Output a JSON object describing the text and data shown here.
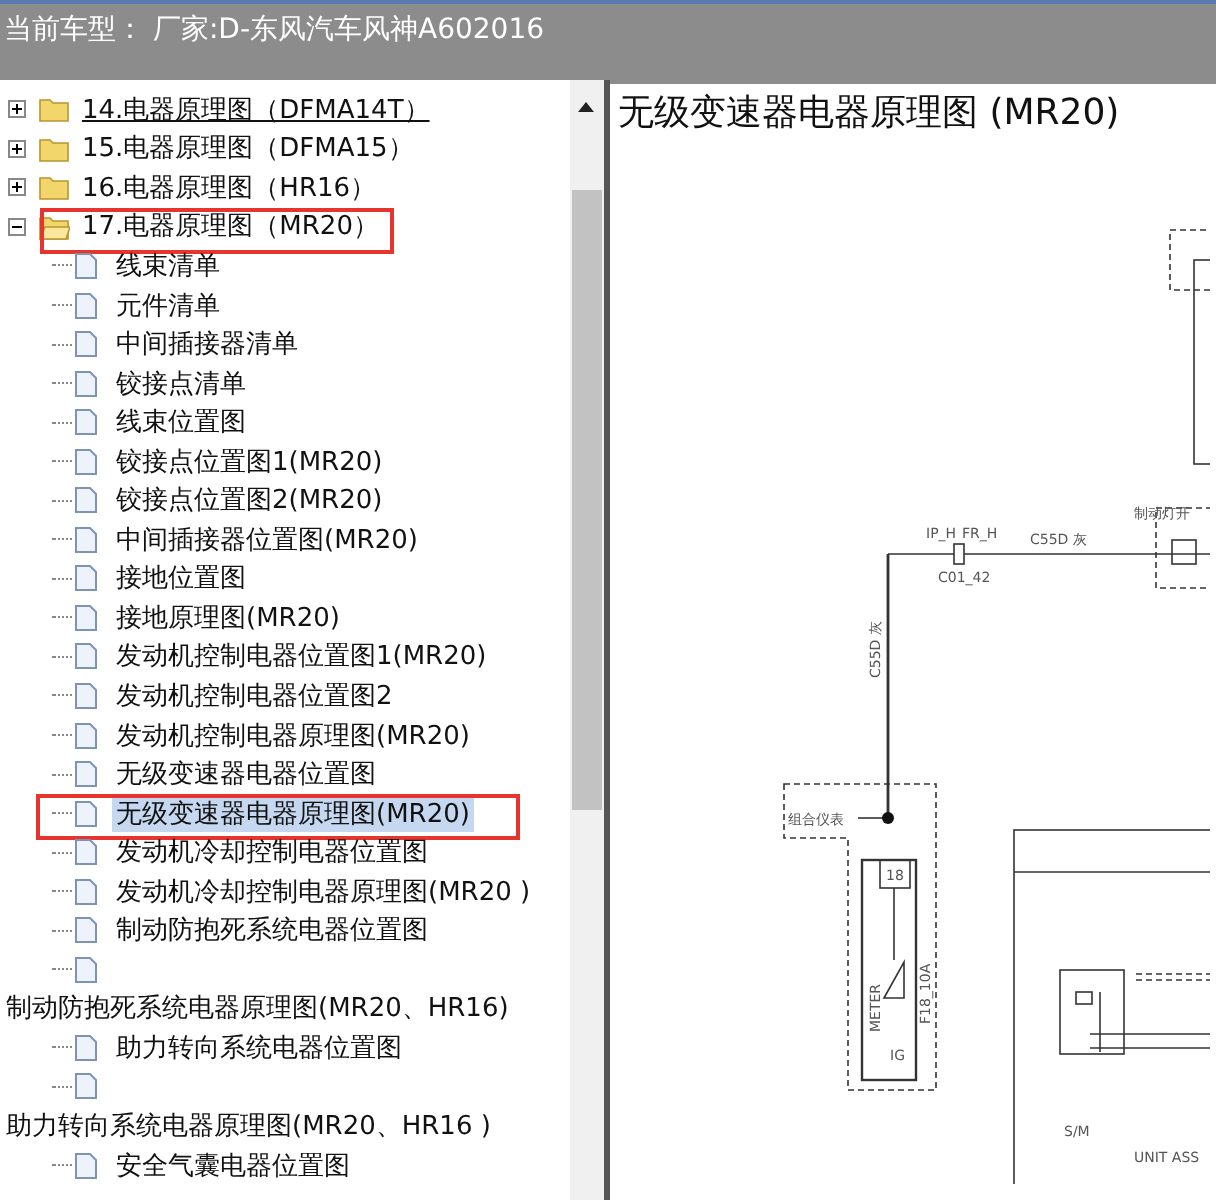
{
  "header": {
    "title": "当前车型： 厂家:D-东风汽车风神A602016"
  },
  "tree": {
    "folders": [
      {
        "label": "14.电器原理图（DFMA14T）",
        "expanded": false,
        "hovered": true,
        "outlined": false
      },
      {
        "label": "15.电器原理图（DFMA15）",
        "expanded": false,
        "hovered": false,
        "outlined": false
      },
      {
        "label": "16.电器原理图（HR16）",
        "expanded": false,
        "hovered": false,
        "outlined": false
      },
      {
        "label": "17.电器原理图（MR20）",
        "expanded": true,
        "hovered": false,
        "outlined": true,
        "children": [
          {
            "label": "线束清单",
            "selected": false,
            "outlined": false
          },
          {
            "label": "元件清单",
            "selected": false,
            "outlined": false
          },
          {
            "label": "中间插接器清单",
            "selected": false,
            "outlined": false
          },
          {
            "label": "铰接点清单",
            "selected": false,
            "outlined": false
          },
          {
            "label": "线束位置图",
            "selected": false,
            "outlined": false
          },
          {
            "label": "铰接点位置图1(MR20)",
            "selected": false,
            "outlined": false
          },
          {
            "label": "铰接点位置图2(MR20)",
            "selected": false,
            "outlined": false
          },
          {
            "label": "中间插接器位置图(MR20)",
            "selected": false,
            "outlined": false
          },
          {
            "label": "接地位置图",
            "selected": false,
            "outlined": false
          },
          {
            "label": "接地原理图(MR20)",
            "selected": false,
            "outlined": false
          },
          {
            "label": "发动机控制电器位置图1(MR20)",
            "selected": false,
            "outlined": false
          },
          {
            "label": "发动机控制电器位置图2",
            "selected": false,
            "outlined": false
          },
          {
            "label": "发动机控制电器原理图(MR20)",
            "selected": false,
            "outlined": false
          },
          {
            "label": "无级变速器电器位置图",
            "selected": false,
            "outlined": false
          },
          {
            "label": "无级变速器电器原理图(MR20)",
            "selected": true,
            "outlined": true
          },
          {
            "label": "发动机冷却控制电器位置图",
            "selected": false,
            "outlined": false
          },
          {
            "label": "发动机冷却控制电器原理图(MR20 )",
            "selected": false,
            "outlined": false
          },
          {
            "label": "制动防抱死系统电器位置图",
            "selected": false,
            "outlined": false
          },
          {
            "wrapped_label": "制动防抱死系统电器原理图(MR20、HR16)",
            "selected": false,
            "outlined": false
          },
          {
            "label": "助力转向系统电器位置图",
            "selected": false,
            "outlined": false
          },
          {
            "wrapped_label": "助力转向系统电器原理图(MR20、HR16 )",
            "selected": false,
            "outlined": false
          },
          {
            "label": "安全气囊电器位置图",
            "selected": false,
            "outlined": false
          }
        ]
      }
    ]
  },
  "document": {
    "title": "无级变速器电器原理图 (MR20)",
    "diagram_labels": [
      "IP_H",
      "FR_H",
      "C01_42",
      "C55D 灰",
      "制动灯开",
      "C55D 灰",
      "组合仪表",
      "18",
      "METER",
      "IG",
      "F18_10A",
      "S/M",
      "UNIT ASS"
    ]
  }
}
